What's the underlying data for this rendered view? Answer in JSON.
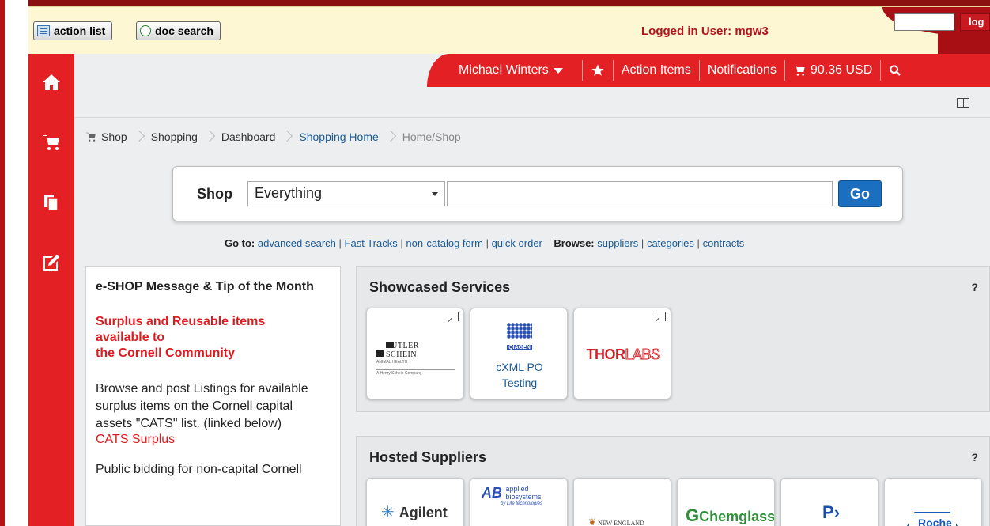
{
  "topbar": {
    "action_list": "action list",
    "doc_search": "doc search",
    "logged_in": "Logged in User: mgw3",
    "logout_label": "log"
  },
  "sidebar": {
    "items": [
      {
        "icon": "home-icon"
      },
      {
        "icon": "cart-icon"
      },
      {
        "icon": "documents-icon"
      },
      {
        "icon": "edit-icon"
      }
    ]
  },
  "header": {
    "user_name": "Michael Winters",
    "action_items": "Action Items",
    "notifications": "Notifications",
    "cart_total": "90.36 USD"
  },
  "breadcrumb": {
    "items": [
      "Shop",
      "Shopping",
      "Dashboard",
      "Shopping Home",
      "Home/Shop"
    ]
  },
  "shop": {
    "label": "Shop",
    "selected": "Everything",
    "search_value": "",
    "go": "Go"
  },
  "goto": {
    "goto_label": "Go to:",
    "links": [
      "advanced search",
      "Fast Tracks",
      "non-catalog form",
      "quick order"
    ],
    "browse_label": "Browse:",
    "browse_links": [
      "suppliers",
      "categories",
      "contracts"
    ]
  },
  "message": {
    "title": "e-SHOP Message & Tip of the Month",
    "red_lines": [
      "Surplus and Reusable items",
      "available to",
      "the Cornell Community"
    ],
    "body": "Browse and post Listings for available surplus items on the Cornell capital assets \"CATS\" list. (linked below)",
    "link": "CATS Surplus",
    "body2": "Public bidding for non-capital Cornell"
  },
  "showcased": {
    "title": "Showcased Services",
    "help": "?",
    "cards": [
      {
        "logo": "BUTLER SCHEIN",
        "sub1": "ANIMAL HEALTH",
        "sub2": "A Henry Schein Company"
      },
      {
        "logo": "QIAGEN",
        "text1": "cXML PO",
        "text2": "Testing"
      },
      {
        "logo_a": "THOR",
        "logo_b": "LABS"
      }
    ]
  },
  "hosted": {
    "title": "Hosted Suppliers",
    "help": "?",
    "cards": [
      {
        "logo": "Agilent"
      },
      {
        "mark": "AB",
        "text1": "applied",
        "text2": "biosystems",
        "sub": "by Life technologies"
      },
      {
        "logo": "NEW ENGLAND"
      },
      {
        "logo": "Chemglass"
      },
      {
        "logo": "P"
      },
      {
        "logo": "Roche"
      }
    ]
  }
}
